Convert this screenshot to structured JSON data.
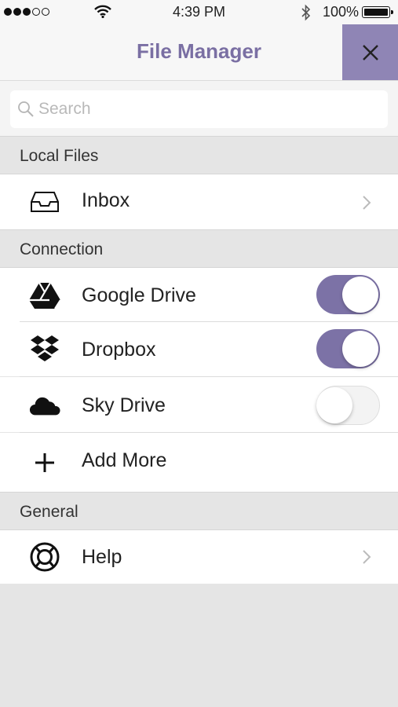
{
  "status_bar": {
    "signal_dots_filled": 3,
    "signal_dots_total": 5,
    "time": "4:39 PM",
    "battery_text": "100%",
    "battery_level": 1.0
  },
  "header": {
    "title": "File Manager",
    "close_icon": "close-icon",
    "accent_color": "#8f85b5",
    "title_color": "#7a6fa3"
  },
  "search": {
    "placeholder": "Search",
    "value": ""
  },
  "sections": {
    "local_files": {
      "label": "Local Files",
      "items": [
        {
          "label": "Inbox",
          "icon": "inbox-icon",
          "accessory": "chevron"
        }
      ]
    },
    "connection": {
      "label": "Connection",
      "items": [
        {
          "label": "Google Drive",
          "icon": "google-drive-icon",
          "enabled": true
        },
        {
          "label": "Dropbox",
          "icon": "dropbox-icon",
          "enabled": true
        },
        {
          "label": "Sky Drive",
          "icon": "sky-drive-icon",
          "enabled": false
        },
        {
          "label": "Add More",
          "icon": "plus-icon"
        }
      ]
    },
    "general": {
      "label": "General",
      "items": [
        {
          "label": "Help",
          "icon": "lifebuoy-icon",
          "accessory": "chevron"
        }
      ]
    }
  },
  "toggle_on_color": "#7c72a6"
}
